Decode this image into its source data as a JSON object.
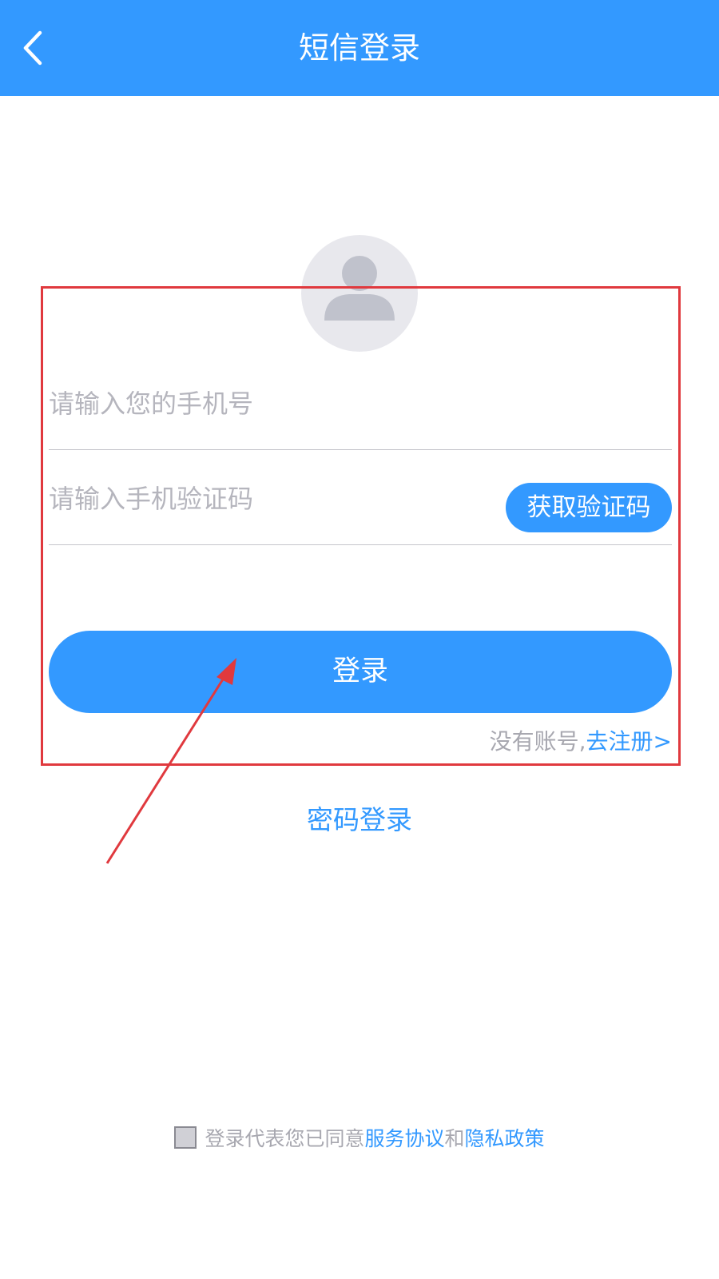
{
  "header": {
    "title": "短信登录",
    "back_icon": "chevron-left-icon",
    "background": "#3399ff"
  },
  "avatar": {
    "icon": "user-avatar-icon"
  },
  "form": {
    "phone_placeholder": "请输入您的手机号",
    "code_placeholder": "请输入手机验证码",
    "get_code_label": "获取验证码",
    "login_label": "登录",
    "no_account_text": "没有账号,",
    "register_link": "去注册>"
  },
  "password_login_label": "密码登录",
  "agreement": {
    "prefix": "登录代表您已同意",
    "service_link": "服务协议",
    "and": "和",
    "privacy_link": "隐私政策"
  },
  "colors": {
    "accent": "#3399ff",
    "annotation": "#e0393e",
    "placeholder": "#b5b5bd"
  }
}
